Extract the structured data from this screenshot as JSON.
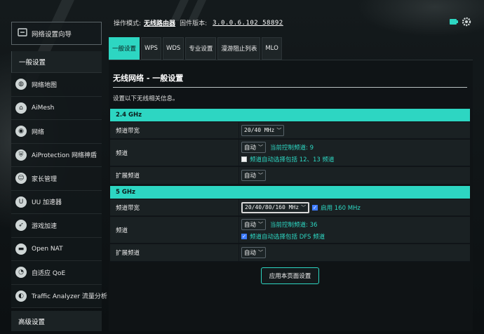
{
  "status": {
    "mode_label": "操作模式:",
    "mode_value": "无线路由器",
    "fw_label": "固件版本:",
    "fw_value": "3.0.0.6.102_58892"
  },
  "sidebar": {
    "qis_label": "网络设置向导",
    "general_header": "一般设置",
    "items": [
      {
        "label": "网络地图",
        "icon": "globe-icon"
      },
      {
        "label": "AiMesh",
        "icon": "mesh-icon"
      },
      {
        "label": "网络",
        "icon": "network-icon"
      },
      {
        "label": "AiProtection 网络神盾",
        "icon": "shield-icon"
      },
      {
        "label": "家长管理",
        "icon": "parental-icon"
      },
      {
        "label": "UU 加速器",
        "icon": "uu-icon"
      },
      {
        "label": "游戏加速",
        "icon": "rocket-icon"
      },
      {
        "label": "Open NAT",
        "icon": "nat-icon"
      },
      {
        "label": "自适应 QoE",
        "icon": "qos-icon"
      },
      {
        "label": "Traffic Analyzer 流量分析",
        "icon": "chart-icon"
      }
    ],
    "advanced_header": "高级设置"
  },
  "tabs": [
    {
      "label": "一般设置",
      "active": true
    },
    {
      "label": "WPS",
      "active": false
    },
    {
      "label": "WDS",
      "active": false
    },
    {
      "label": "专业设置",
      "active": false
    },
    {
      "label": "漫游阻止列表",
      "active": false
    },
    {
      "label": "MLO",
      "active": false
    }
  ],
  "panel": {
    "title": "无线网络 - 一般设置",
    "description": "设置以下无线相关信息。",
    "band24": {
      "header": "2.4 GHz",
      "bandwidth_label": "频道带宽",
      "bandwidth_value": "20/40 MHz",
      "channel_label": "频道",
      "channel_value": "自动",
      "channel_info": "当前控制频道: 9",
      "channel_checkbox": "频道自动选择包括 12、13 频道",
      "channel_checked": false,
      "ext_label": "扩展频道",
      "ext_value": "自动"
    },
    "band5": {
      "header": "5 GHz",
      "bandwidth_label": "频道带宽",
      "bandwidth_value": "20/40/80/160 MHz",
      "bandwidth_checkbox": "启用 160 MHz",
      "bandwidth_checked": true,
      "channel_label": "频道",
      "channel_value": "自动",
      "channel_info": "当前控制频道: 36",
      "channel_checkbox": "频道自动选择包括 DFS 频道",
      "channel_checked": true,
      "ext_label": "扩展频道",
      "ext_value": "自动"
    },
    "apply_label": "应用本页面设置"
  },
  "colors": {
    "accent": "#2dd6c2",
    "background": "#0e1214",
    "checkbox_on": "#3d7bff"
  }
}
